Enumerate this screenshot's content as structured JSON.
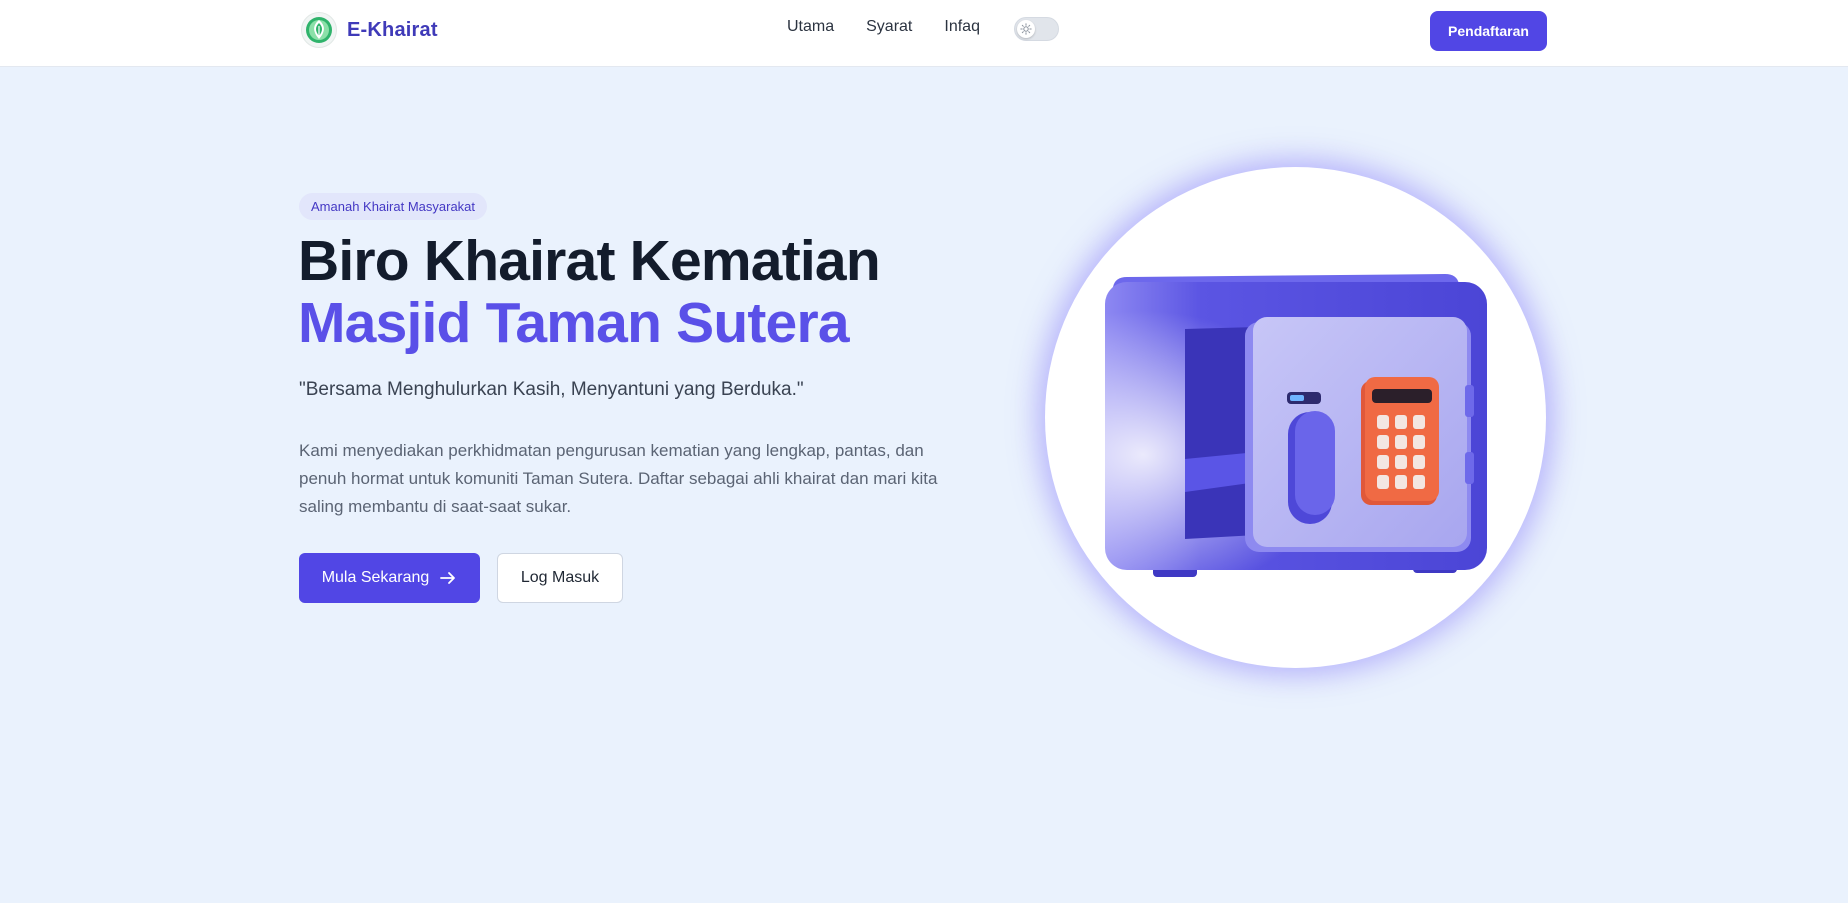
{
  "header": {
    "brand_name": "E-Khairat",
    "logo_icon": "mosque-leaf-logo-icon",
    "nav": [
      {
        "label": "Utama"
      },
      {
        "label": "Syarat"
      },
      {
        "label": "Infaq"
      }
    ],
    "theme_toggle_icon": "sun-icon",
    "register_label": "Pendaftaran"
  },
  "hero": {
    "badge": "Amanah Khairat Masyarakat",
    "title_line1": "Biro Khairat Kematian",
    "title_line2": "Masjid Taman Sutera",
    "tagline": "\"Bersama Menghulurkan Kasih, Menyantuni yang Berduka.\"",
    "description": "Kami menyediakan perkhidmatan pengurusan kematian yang lengkap, pantas, dan penuh hormat untuk komuniti Taman Sutera. Daftar sebagai ahli khairat dan mari kita saling membantu di saat-saat sukar.",
    "primary_button": "Mula Sekarang",
    "primary_button_icon": "arrow-right-icon",
    "secondary_button": "Log Masuk",
    "illustration": "safe-box-illustration"
  },
  "colors": {
    "accent": "#5146e5",
    "title_accent": "#5a50e8",
    "background": "#eaf2fd",
    "title_dark": "#131c2c"
  }
}
